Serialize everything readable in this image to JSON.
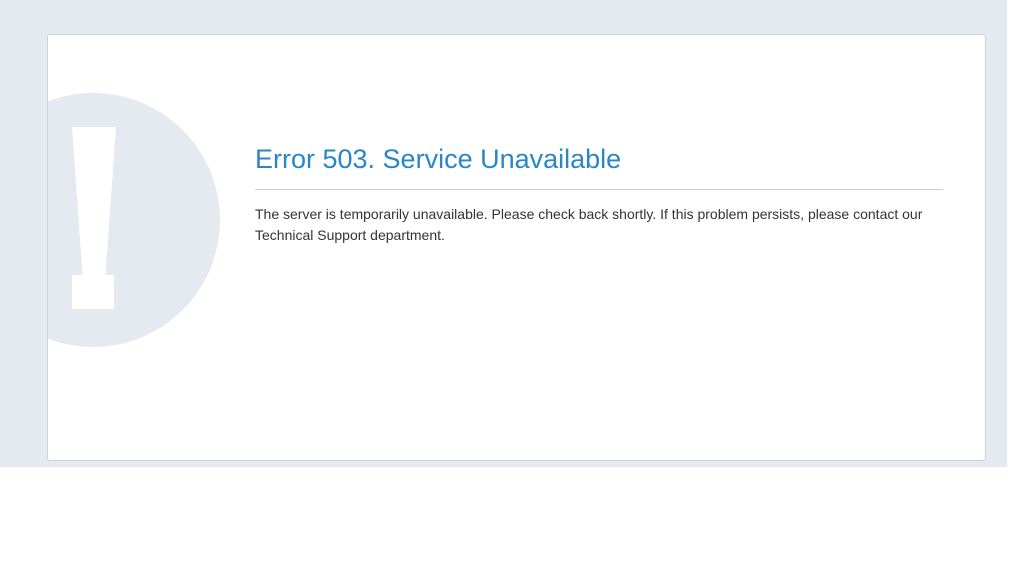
{
  "colors": {
    "page_background": "#e5eaf0",
    "card_background": "#ffffff",
    "title": "#2a86c7",
    "text": "#333333",
    "icon_circle": "#e5eaf0"
  },
  "icon": {
    "name": "exclamation-warning-icon"
  },
  "error": {
    "title": "Error 503. Service Unavailable",
    "message": "The server is temporarily unavailable. Please check back shortly. If this problem persists, please contact our Technical Support department."
  }
}
